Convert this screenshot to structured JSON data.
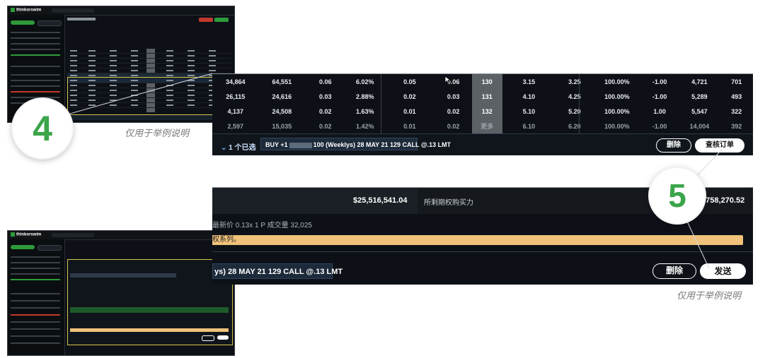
{
  "steps": {
    "step4": "4",
    "step5": "5"
  },
  "caption": "仅用于举例说明",
  "thumb_top": {
    "logo": "thinkorswim"
  },
  "thumb_bottom": {
    "logo": "thinkorswim"
  },
  "chain": {
    "rows": [
      {
        "vol": "34,864",
        "oi": "64,551",
        "c3": "0.06",
        "pct": "6.02%",
        "bid": "0.05",
        "ask": "0.06",
        "strike": "130",
        "bid2": "3.15",
        "ask2": "3.25",
        "prob": "100.00%",
        "delta": "-1.00",
        "vol2": "4,721",
        "oi2": "701"
      },
      {
        "vol": "26,115",
        "oi": "24,616",
        "c3": "0.03",
        "pct": "2.88%",
        "bid": "0.02",
        "ask": "0.03",
        "strike": "131",
        "bid2": "4.10",
        "ask2": "4.25",
        "prob": "100.00%",
        "delta": "-1.00",
        "vol2": "5,289",
        "oi2": "493"
      },
      {
        "vol": "4,137",
        "oi": "24,508",
        "c3": "0.02",
        "pct": "1.63%",
        "bid": "0.01",
        "ask": "0.02",
        "strike": "132",
        "bid2": "5.10",
        "ask2": "5.20",
        "prob": "100.00%",
        "delta": "1.00",
        "vol2": "5,547",
        "oi2": "322"
      },
      {
        "vol": "2,597",
        "oi": "15,035",
        "c3": "0.02",
        "pct": "1.42%",
        "bid": "0.01",
        "ask": "0.02",
        "strike": "更多",
        "bid2": "6.10",
        "ask2": "6.20",
        "prob": "100.00%",
        "delta": "-1.00",
        "vol2": "14,004",
        "oi2": "392"
      }
    ],
    "selected_label": "1 个已选",
    "order_prefix": "BUY +1",
    "order_suffix": "100 (Weeklys) 28 MAY 21 129 CALL @.13 LMT",
    "delete_label": "删除",
    "review_label": "查核订单"
  },
  "confirm": {
    "amount": "$25,516,541.04",
    "buying_power_label": "所剩期权购买力",
    "buying_power_value": "1,758,270.52",
    "last_price_line": "最新价 0.13x 1 P  成交量 32,025",
    "warning_text": "权系列。",
    "order_text": "ys) 28 MAY 21 129 CALL @.13 LMT",
    "delete_label": "删除",
    "send_label": "发送"
  },
  "colors": {
    "accent_green": "#3ba54a",
    "panel_bg": "#0d1117",
    "warning": "#f0c27a"
  }
}
